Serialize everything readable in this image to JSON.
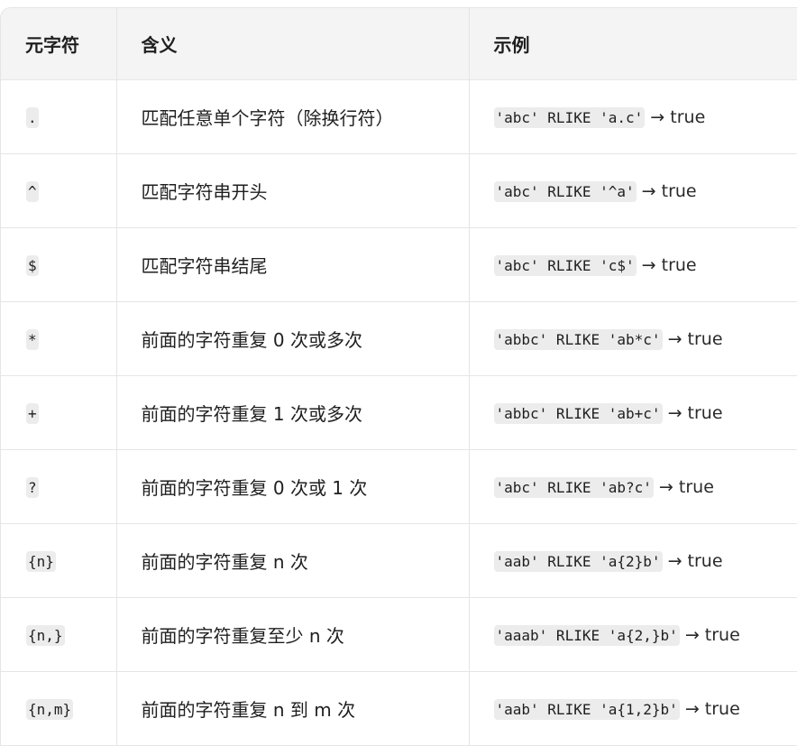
{
  "headers": {
    "meta": "元字符",
    "meaning": "含义",
    "example": "示例"
  },
  "rows": [
    {
      "meta": ".",
      "meaning": "匹配任意单个字符（除换行符）",
      "example_code": "'abc' RLIKE 'a.c'",
      "example_result": " → true"
    },
    {
      "meta": "^",
      "meaning": "匹配字符串开头",
      "example_code": "'abc' RLIKE '^a'",
      "example_result": " → true"
    },
    {
      "meta": "$",
      "meaning": "匹配字符串结尾",
      "example_code": "'abc' RLIKE 'c$'",
      "example_result": " → true"
    },
    {
      "meta": "*",
      "meaning": "前面的字符重复 0 次或多次",
      "example_code": "'abbc' RLIKE 'ab*c'",
      "example_result": " → true"
    },
    {
      "meta": "+",
      "meaning": "前面的字符重复 1 次或多次",
      "example_code": "'abbc' RLIKE 'ab+c'",
      "example_result": " → true"
    },
    {
      "meta": "?",
      "meaning": "前面的字符重复 0 次或 1 次",
      "example_code": "'abc' RLIKE 'ab?c'",
      "example_result": " → true"
    },
    {
      "meta": "{n}",
      "meaning": "前面的字符重复 n 次",
      "example_code": "'aab' RLIKE 'a{2}b'",
      "example_result": " → true"
    },
    {
      "meta": "{n,}",
      "meaning": "前面的字符重复至少 n 次",
      "example_code": "'aaab' RLIKE 'a{2,}b'",
      "example_result": " → true"
    },
    {
      "meta": "{n,m}",
      "meaning": "前面的字符重复 n 到 m 次",
      "example_code": "'aab' RLIKE 'a{1,2}b'",
      "example_result": " → true"
    }
  ]
}
